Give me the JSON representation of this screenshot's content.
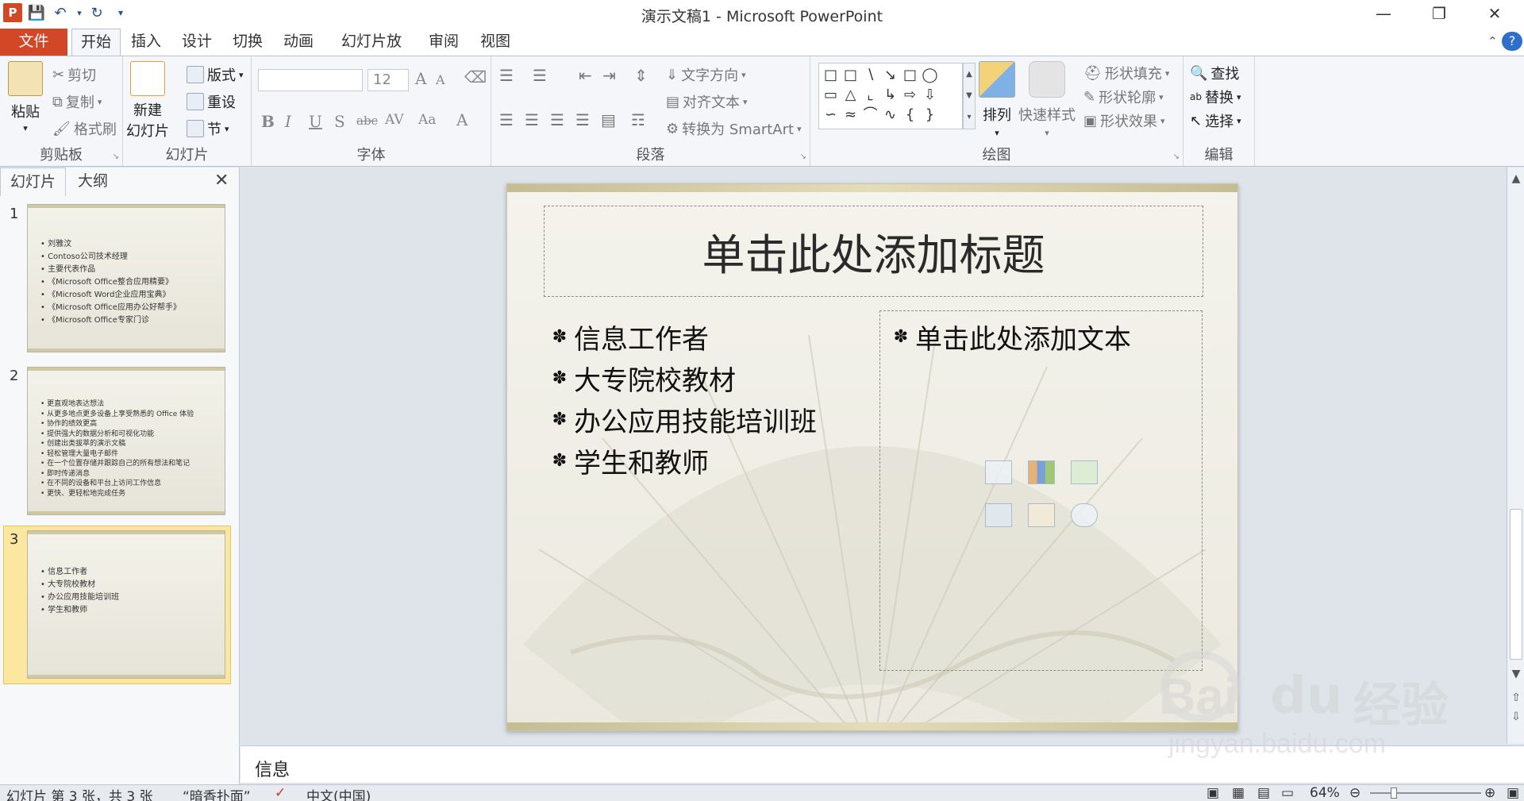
{
  "window": {
    "title": "演示文稿1 - Microsoft PowerPoint"
  },
  "tabs": [
    {
      "label": "文件"
    },
    {
      "label": "开始"
    },
    {
      "label": "插入"
    },
    {
      "label": "设计"
    },
    {
      "label": "切换"
    },
    {
      "label": "动画"
    },
    {
      "label": "幻灯片放映"
    },
    {
      "label": "审阅"
    },
    {
      "label": "视图"
    }
  ],
  "ribbon": {
    "clipboard": {
      "paste": "粘贴",
      "cut": "剪切",
      "copy": "复制",
      "format_painter": "格式刷",
      "label": "剪贴板"
    },
    "slides": {
      "new_slide_line1": "新建",
      "new_slide_line2": "幻灯片",
      "layout": "版式",
      "reset": "重设",
      "section": "节",
      "label": "幻灯片"
    },
    "font": {
      "font_name": "",
      "font_size": "12",
      "label": "字体",
      "bold": "B",
      "italic": "I",
      "underline": "U",
      "shadow": "S",
      "strike": "abc",
      "spacing": "AV",
      "case": "Aa",
      "color": "A",
      "grow": "A",
      "shrink": "A"
    },
    "paragraph": {
      "text_direction": "文字方向",
      "align_text": "对齐文本",
      "smartart": "转换为 SmartArt",
      "label": "段落"
    },
    "drawing": {
      "arrange": "排列",
      "quick_styles": "快速样式",
      "shape_fill": "形状填充",
      "shape_outline": "形状轮廓",
      "shape_effects": "形状效果",
      "label": "绘图"
    },
    "editing": {
      "find": "查找",
      "replace": "替换",
      "select": "选择",
      "label": "编辑"
    }
  },
  "panel": {
    "tabs": [
      {
        "label": "幻灯片"
      },
      {
        "label": "大纲"
      }
    ],
    "slides": [
      {
        "number": "1",
        "bullets": [
          "刘雅汶",
          "Contoso公司技术经理",
          "主要代表作品",
          "《Microsoft Office整合应用精要》",
          "《Microsoft Word企业应用宝典》",
          "《Microsoft Office应用办公好帮手》",
          "《Microsoft Office专家门诊"
        ]
      },
      {
        "number": "2",
        "bullets": [
          "更直观地表达想法",
          "从更多地点更多设备上享受熟悉的 Office 体验",
          "协作的绩效更高",
          "提供强大的数据分析和可视化功能",
          "创建出类拔萃的演示文稿",
          "轻松管理大量电子邮件",
          "在一个位置存储并跟踪自己的所有想法和笔记",
          "即时传递消息",
          "在不同的设备和平台上访问工作信息",
          "更快、更轻松地完成任务"
        ]
      },
      {
        "number": "3",
        "bullets": [
          "信息工作者",
          "大专院校教材",
          "办公应用技能培训班",
          "学生和教师"
        ]
      }
    ]
  },
  "slide": {
    "title": "单击此处添加标题",
    "left_bullets": [
      "信息工作者",
      "大专院校教材",
      "办公应用技能培训班",
      "学生和教师"
    ],
    "right_placeholder": "单击此处添加文本"
  },
  "notes": {
    "text": "信息"
  },
  "status": {
    "slide_info": "幻灯片 第 3 张，共 3 张",
    "theme": "“暗香扑面”",
    "language": "中文(中国)",
    "zoom": "64%"
  },
  "watermark": {
    "brand": "Bai",
    "brand2": "经验",
    "url": "jingyan.baidu.com"
  },
  "colors": {
    "file_tab": "#d24726",
    "selected_thumb": "#fce7a0"
  }
}
